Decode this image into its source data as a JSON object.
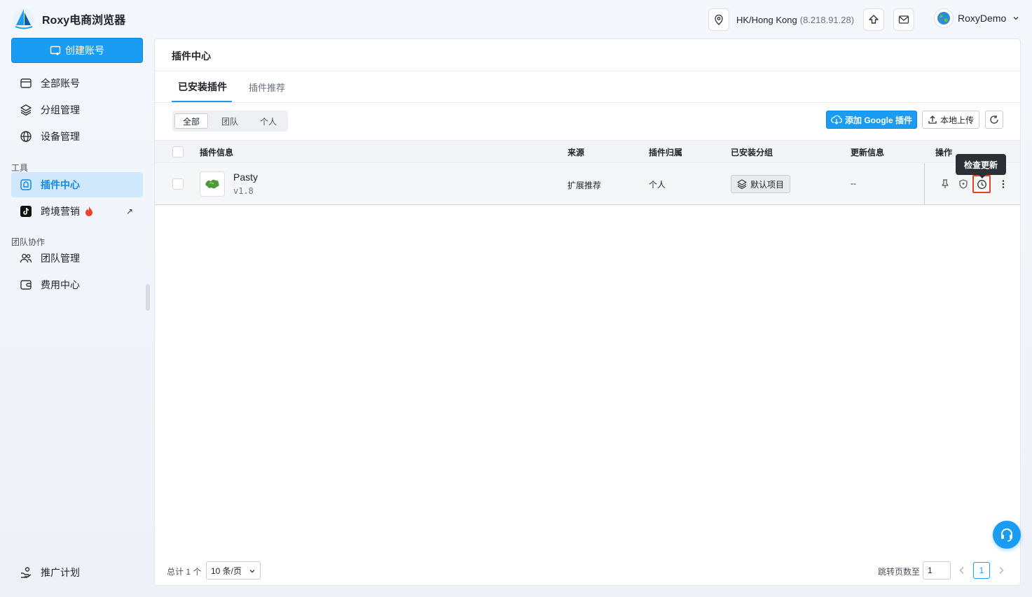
{
  "app": {
    "title": "Roxy电商浏览器"
  },
  "sidebar": {
    "create_button": "创建账号",
    "items": [
      {
        "label": "全部账号",
        "icon": "window-icon"
      },
      {
        "label": "分组管理",
        "icon": "layers-icon"
      },
      {
        "label": "设备管理",
        "icon": "globe-icon"
      }
    ],
    "section_tools": "工具",
    "tools": [
      {
        "label": "插件中心",
        "icon": "puzzle-icon",
        "active": true
      },
      {
        "label": "跨境营销",
        "icon": "tiktok-icon",
        "badge": "fire-icon",
        "ext": "↗"
      }
    ],
    "section_team": "团队协作",
    "team": [
      {
        "label": "团队管理",
        "icon": "users-icon"
      },
      {
        "label": "费用中心",
        "icon": "wallet-icon"
      }
    ],
    "bottom": {
      "label": "推广计划",
      "icon": "handshake-icon"
    }
  },
  "topbar": {
    "location": "HK/Hong Kong",
    "ip": "(8.218.91.28)",
    "user": "RoxyDemo"
  },
  "main": {
    "title": "插件中心",
    "tabs": [
      {
        "label": "已安装插件",
        "active": true
      },
      {
        "label": "插件推荐",
        "active": false
      }
    ],
    "filters": [
      "全部",
      "团队",
      "个人"
    ],
    "add_google": "添加 Google 插件",
    "local_upload": "本地上传",
    "table": {
      "columns": [
        "插件信息",
        "来源",
        "插件归属",
        "已安装分组",
        "更新信息",
        "操作"
      ],
      "rows": [
        {
          "name": "Pasty",
          "version": "v1.8",
          "source": "扩展推荐",
          "owner": "个人",
          "group": "默认项目",
          "update": "--"
        }
      ]
    },
    "tooltip": "检查更新",
    "footer": {
      "total": "总计 1 个",
      "page_size": "10 条/页",
      "jump_label": "跳转页数至",
      "jump_value": "1",
      "current_page": "1"
    }
  },
  "colors": {
    "accent": "#1a9cf3",
    "active_bg": "#cfe8fb",
    "highlight": "#e0452b"
  }
}
